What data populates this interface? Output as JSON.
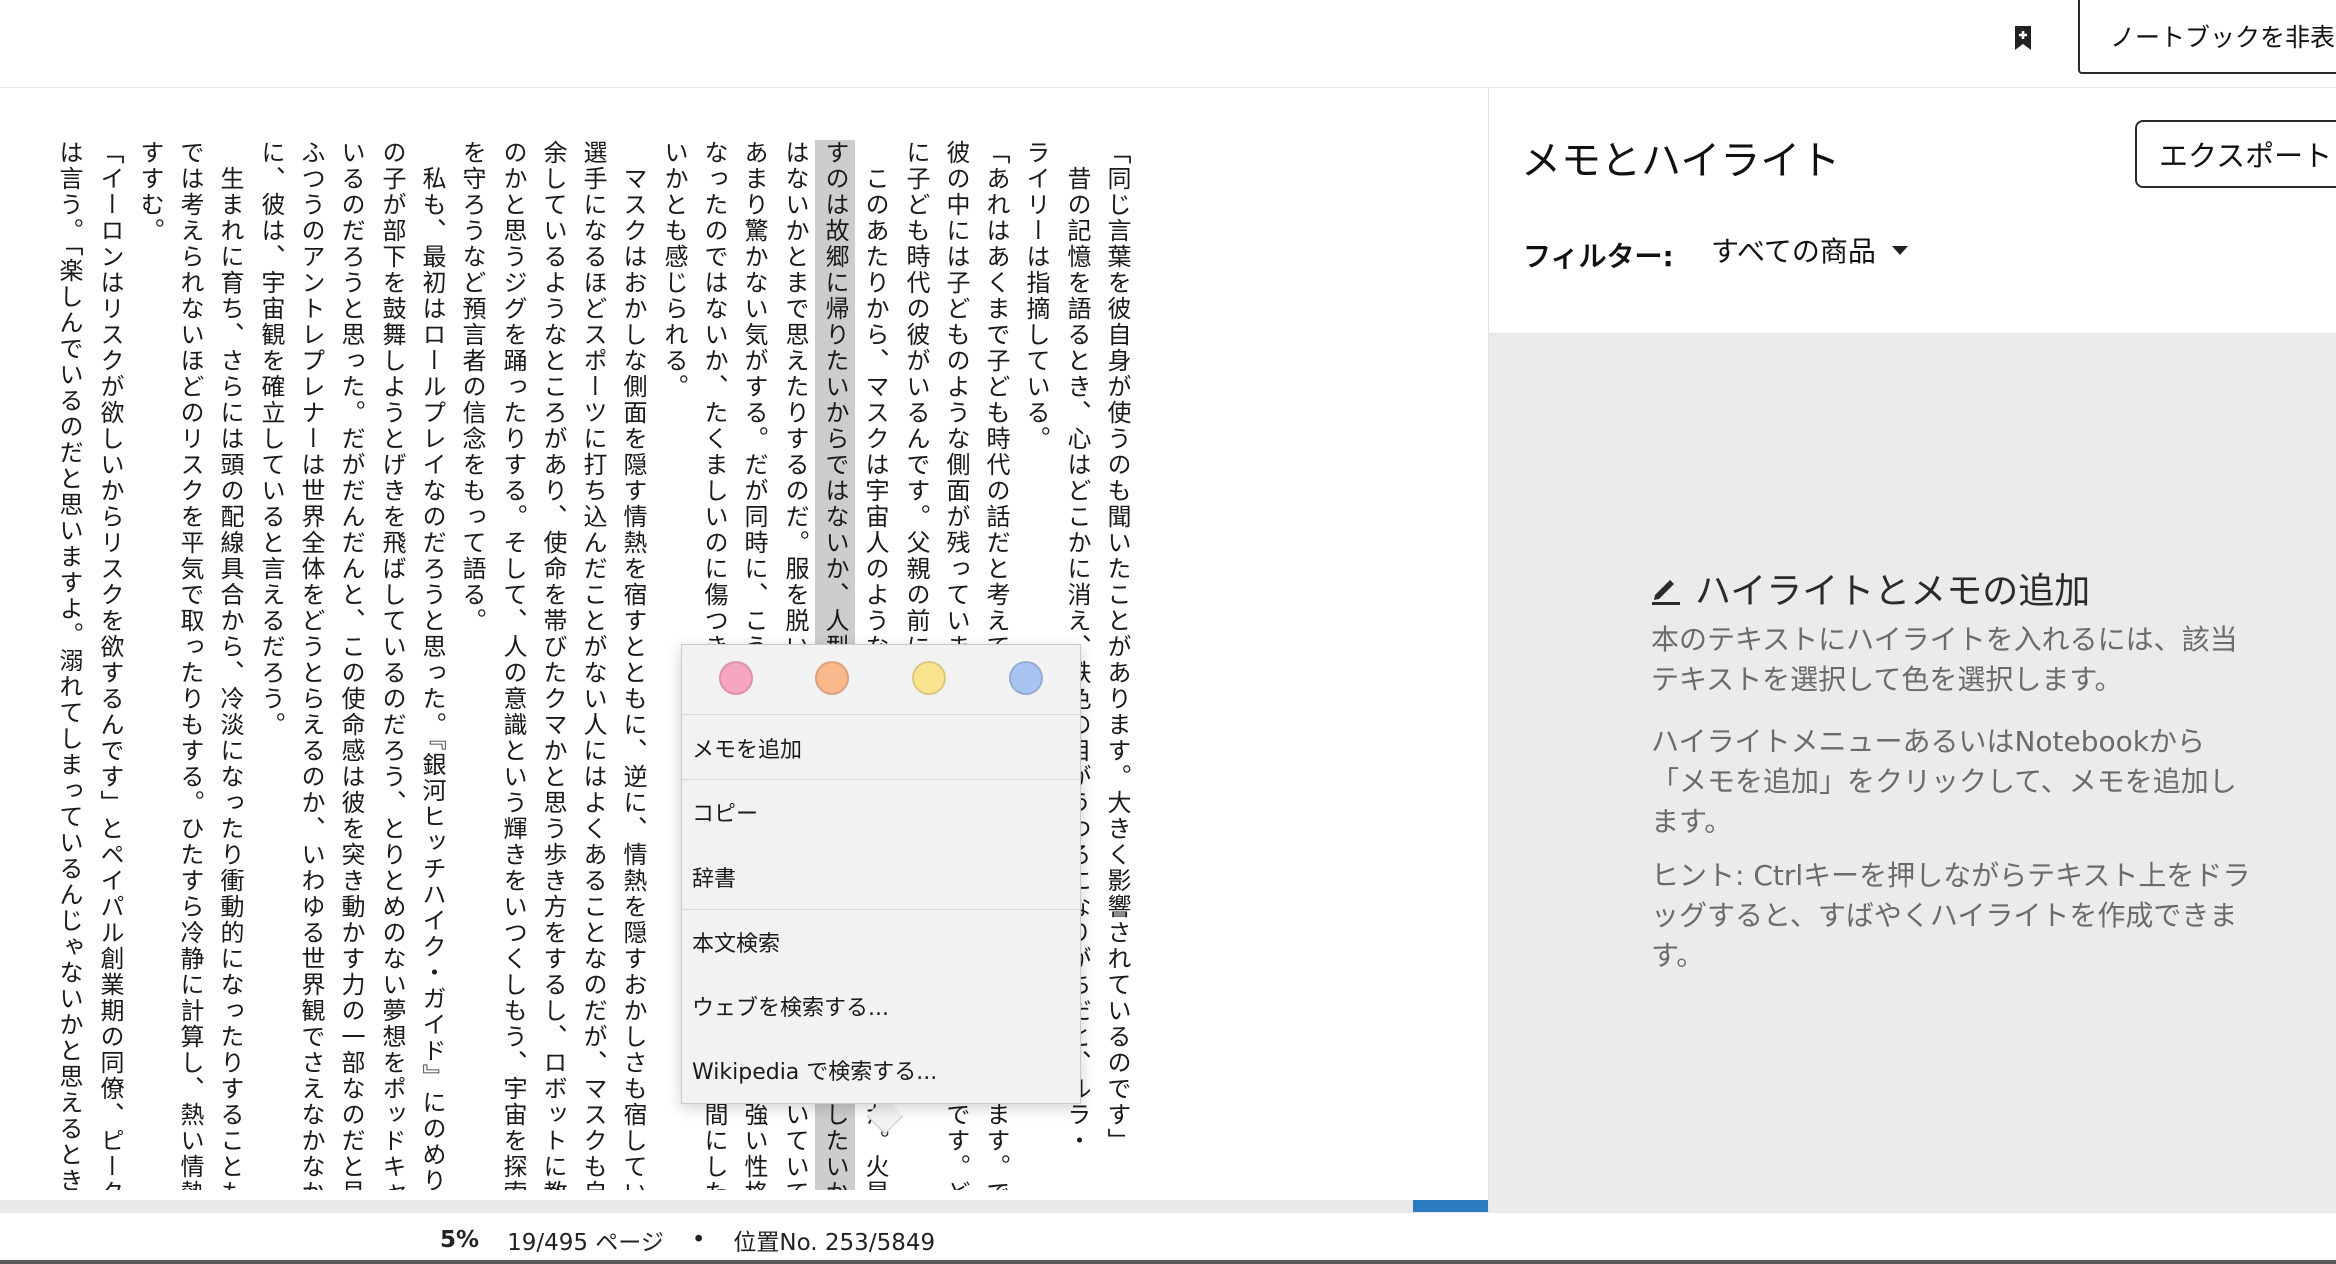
{
  "topbar": {
    "hide_notebook_label": "ノートブックを非表示"
  },
  "reader": {
    "columns": [
      "「同じ言葉を彼自身が使うのも聞いたことがあります。大きく影響されているのです」",
      "　昔の記憶を語るとき、心はどこかに消え、鉄色の目がうつろになりがちだと、ルラ・",
      "ライリーは指摘している。",
      "「あれはあくまで子ども時代の話だと考えていて、彼は自分が変わったと思っています。でも",
      "彼の中には子どものような側面が残っています。成長し切れていない部分があるんです。どこか",
      "に子ども時代の彼がいるんです。父親の前に立つ子どもがね」",
      "　このあたりから、マスクは宇宙人のようなオーラを放つようになったのではないか。火星をめざ",
      "すのは故郷に帰りたいからではないか、人型ロボットに夢中になるのは人間を理解したいからで",
      "はないかとまで思えたりするのだ。服を脱いだらへその代わりに宇宙のマークが付いていても、",
      "あまり驚かない気がする。だが同時に、こういう子ども時代の経験が、彼を打たれ強い性格的に",
      "なったのではないか、たくましいのに傷つきやすい、子どもっぽいのに大人びた人間にしたのではな",
      "いかとも感じられる。",
      "　マスクはおかしな側面を隠す情熱を宿すとともに、逆に、情熱を隠すおかしさも宿している。大柄で、",
      "選手になるほどスポーツに打ち込んだことがない人にはよくあることなのだが、マスクも自分の体を持て",
      "余しているようなところがあり、使命を帯びたクマかと思う歩き方をするし、ロボットに教えてもらった",
      "のかと思うジグを踊ったりする。そして、人の意識という輝きをいつくしもう、宇宙を探索しよう、地球",
      "を守ろうなど預言者の信念をもって語る。",
      "　私も、最初はロールプレイなのだろうと思った。『銀河ヒッチハイク・ガイド』にのめり込みすぎた男",
      "の子が部下を鼓舞しようとげきを飛ばしているのだろう、とりとめのない夢想をポッドキャストで語って",
      "いるのだろうと思った。だがだんだんと、この使命感は彼を突き動かす力の一部なのだと見方が変わった。",
      "ふつうのアントレプレナーは世界全体をどうとらえるのか、いわゆる世界観でさえなかなか得られないの",
      "に、彼は、宇宙観を確立していると言えるだろう。",
      "　生まれに育ち、さらには頭の配線具合から、冷淡になったり衝動的になったりすることもある。ふつう",
      "では考えられないほどのリスクを平気で取ったりもする。ひたすら冷静に計算し、熱い情熱をもって突き",
      "すすむ。",
      "「イーロンはリスクが欲しいからリスクを欲するんです」とペイパル創業期の同僚、ピーター・ティール",
      "は言う。「楽しんでいるのだと思いますよ。溺れてしまっているんじゃないかと思えるときもありますね」"
    ],
    "highlighted_column": 7,
    "selected_column": 8
  },
  "context_menu": {
    "colors": [
      {
        "name": "pink",
        "hex": "#f7a6c0"
      },
      {
        "name": "orange",
        "hex": "#f9b98c"
      },
      {
        "name": "yellow",
        "hex": "#f7e48c"
      },
      {
        "name": "blue",
        "hex": "#a9c4f2"
      }
    ],
    "items": [
      "メモを追加",
      "コピー",
      "辞書",
      "本文検索",
      "ウェブを検索する...",
      "Wikipedia で検索する..."
    ]
  },
  "notebook": {
    "title": "メモとハイライト",
    "export_label": "エクスポート",
    "filter_label": "フィルター:",
    "filter_value": "すべての商品",
    "empty_heading": "ハイライトとメモの追加",
    "paragraphs": [
      "本のテキストにハイライトを入れるには、該当テキストを選択して色を選択します。",
      "ハイライトメニューあるいはNotebookから「メモを追加」をクリックして、メモを追加します。",
      "ヒント: Ctrlキーを押しながらテキスト上をドラッグすると、すばやくハイライトを作成できます。"
    ]
  },
  "footer": {
    "percent": "5%",
    "page": "19/495 ページ",
    "separator": "•",
    "location": "位置No. 253/5849",
    "progress_fraction": 0.05
  },
  "colors": {
    "highlight": "#cdcdcd",
    "progress": "#2b7bc0",
    "notebook_bg": "#ebebeb",
    "menu_bg": "#f2f2f2"
  }
}
